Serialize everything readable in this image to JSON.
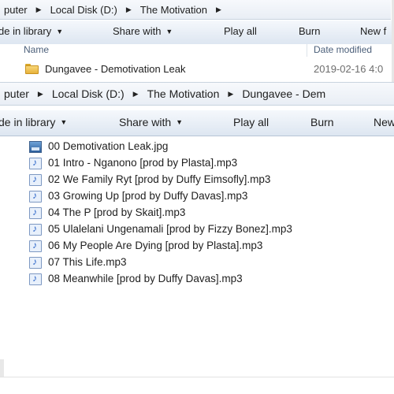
{
  "window1": {
    "breadcrumb": [
      "puter",
      "Local Disk (D:)",
      "The Motivation"
    ],
    "toolbar": {
      "include_label": "de in library",
      "share_label": "Share with",
      "playall_label": "Play all",
      "burn_label": "Burn",
      "newfolder_label": "New f"
    },
    "columns": {
      "name": "Name",
      "date": "Date modified"
    },
    "folder": {
      "name": "Dungavee - Demotivation Leak",
      "date": "2019-02-16 4:0"
    }
  },
  "window2": {
    "breadcrumb": [
      "puter",
      "Local Disk (D:)",
      "The Motivation",
      "Dungavee - Dem"
    ],
    "toolbar": {
      "include_label": "de in library",
      "share_label": "Share with",
      "playall_label": "Play all",
      "burn_label": "Burn",
      "new_label": "New"
    },
    "files": [
      {
        "name": "00 Demotivation Leak.jpg",
        "icon": "image-file-icon"
      },
      {
        "name": "01 Intro - Nganono [prod by Plasta].mp3",
        "icon": "audio-file-icon"
      },
      {
        "name": "02 We Family Ryt [prod by Duffy Eimsofly].mp3",
        "icon": "audio-file-icon"
      },
      {
        "name": "03 Growing Up [prod by Duffy Davas].mp3",
        "icon": "audio-file-icon"
      },
      {
        "name": "04 The P [prod by Skait].mp3",
        "icon": "audio-file-icon"
      },
      {
        "name": "05 Ulalelani Ungenamali [prod by Fizzy Bonez].mp3",
        "icon": "audio-file-icon"
      },
      {
        "name": "06 My People Are Dying [prod by Plasta].mp3",
        "icon": "audio-file-icon"
      },
      {
        "name": "07 This Life.mp3",
        "icon": "audio-file-icon"
      },
      {
        "name": "08 Meanwhile [prod by Duffy Davas].mp3",
        "icon": "audio-file-icon"
      }
    ]
  }
}
